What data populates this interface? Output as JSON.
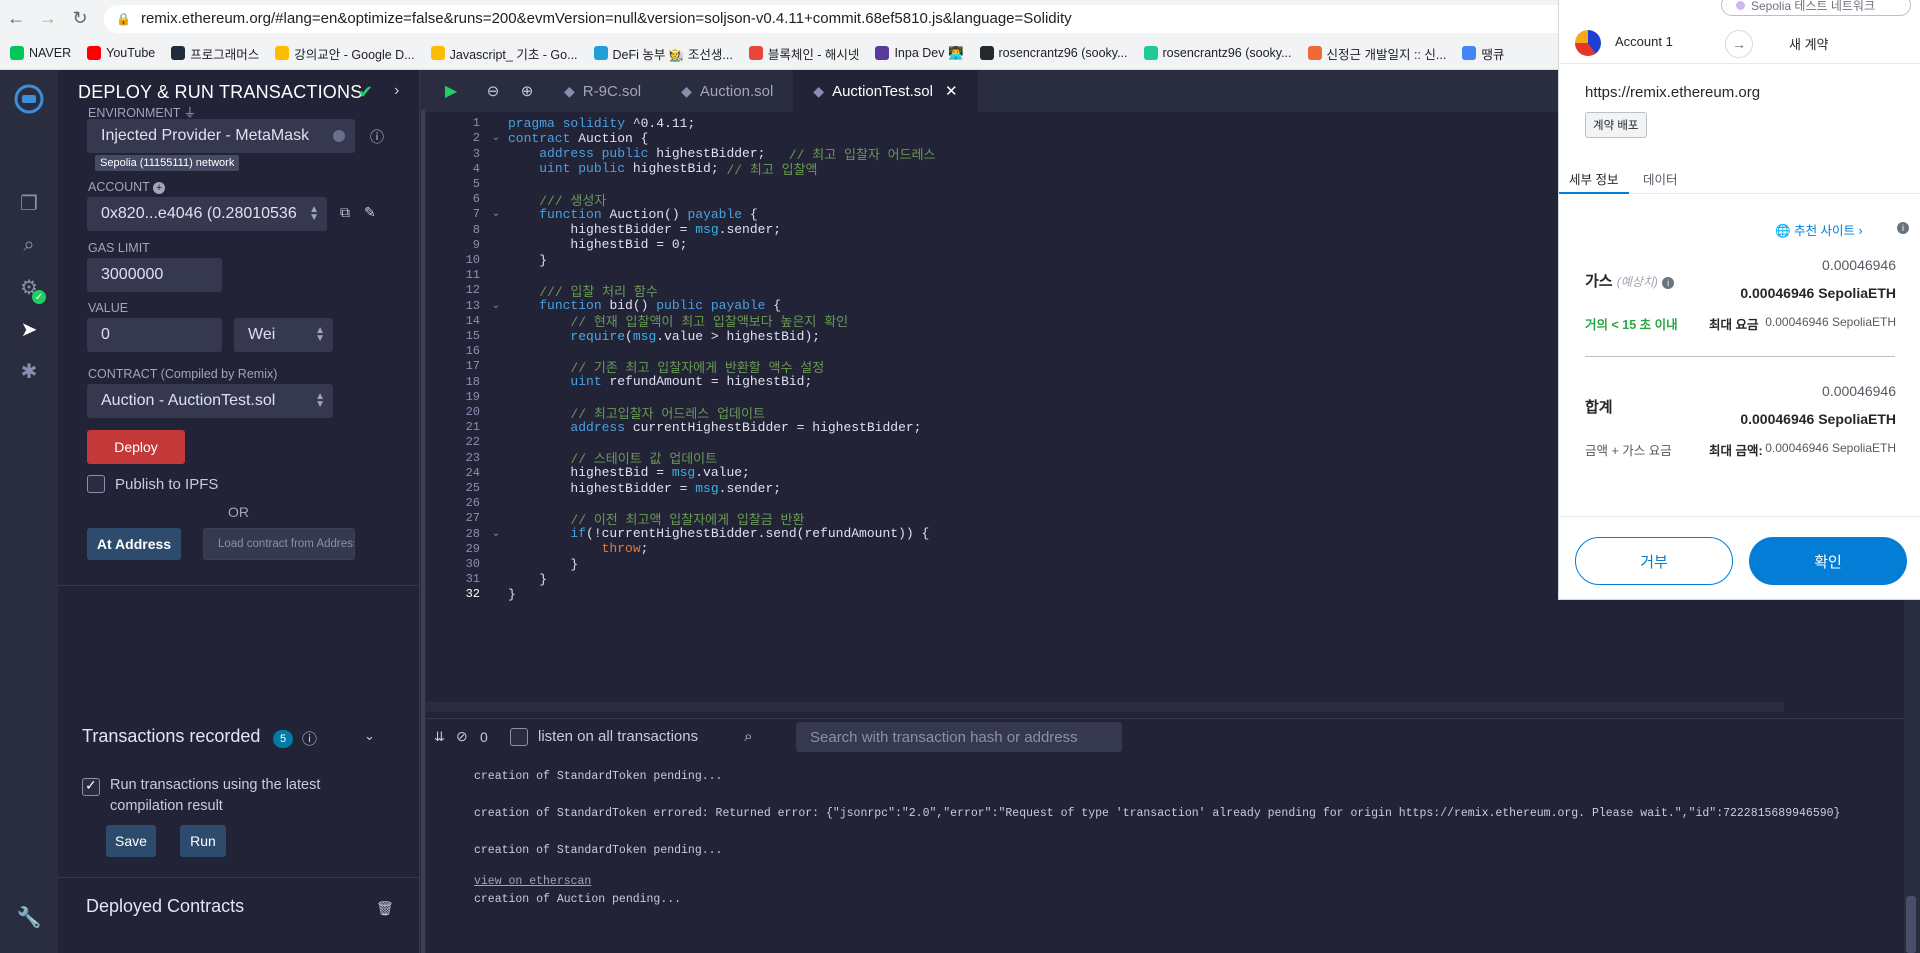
{
  "browser": {
    "url": "remix.ethereum.org/#lang=en&optimize=false&runs=200&evmVersion=null&version=soljson-v0.4.11+commit.68ef5810.js&language=Solidity",
    "bookmarks": [
      {
        "label": "NAVER",
        "color": "#03c75a"
      },
      {
        "label": "YouTube",
        "color": "#ff0000"
      },
      {
        "label": "프로그래머스",
        "color": "#202b3d"
      },
      {
        "label": "강의교안 - Google D...",
        "color": "#fbbc04"
      },
      {
        "label": "Javascript_ 기초 - Go...",
        "color": "#fbbc04"
      },
      {
        "label": "DeFi 농부 🧑‍🌾 조선생...",
        "color": "#229ed9"
      },
      {
        "label": "블록체인 - 해시넷",
        "color": "#e8453c"
      },
      {
        "label": "Inpa Dev 👨‍💻",
        "color": "#5b3a9e"
      },
      {
        "label": "rosencrantz96 (sooky...",
        "color": "#24292f"
      },
      {
        "label": "rosencrantz96 (sooky...",
        "color": "#20c997"
      },
      {
        "label": "신정근 개발일지 :: 신...",
        "color": "#f06a35"
      },
      {
        "label": "땡큐",
        "color": "#4285f4"
      }
    ]
  },
  "panel": {
    "title": "DEPLOY & RUN TRANSACTIONS",
    "environment_label": "ENVIRONMENT",
    "environment_value": "Injected Provider - MetaMask",
    "network_badge": "Sepolia (11155111) network",
    "account_label": "ACCOUNT",
    "account_value": "0x820...e4046 (0.28010536",
    "gas_limit_label": "GAS LIMIT",
    "gas_limit_value": "3000000",
    "value_label": "VALUE",
    "value_amount": "0",
    "value_unit": "Wei",
    "contract_label": "CONTRACT (Compiled by Remix)",
    "contract_value": "Auction - AuctionTest.sol",
    "deploy_label": "Deploy",
    "publish_label": "Publish to IPFS",
    "or_label": "OR",
    "at_address_label": "At Address",
    "load_placeholder": "Load contract from Address",
    "tx_recorded_label": "Transactions recorded",
    "tx_recorded_count": "5",
    "run_latest_label": "Run transactions using the latest compilation result",
    "save_label": "Save",
    "run_label": "Run",
    "deployed_label": "Deployed Contracts"
  },
  "editor": {
    "tabs": [
      "R-9C.sol",
      "Auction.sol",
      "AuctionTest.sol"
    ],
    "active_tab": "AuctionTest.sol"
  },
  "terminal": {
    "count": "0",
    "listen_label": "listen on all transactions",
    "search_placeholder": "Search with transaction hash or address",
    "lines": [
      "creation of StandardToken pending...",
      "creation of StandardToken errored: Returned error: {\"jsonrpc\":\"2.0\",\"error\":\"Request of type 'transaction' already pending for origin https://remix.ethereum.org. Please wait.\",\"id\":7222815689946590}",
      "creation of StandardToken pending...",
      "view on etherscan",
      "creation of Auction pending..."
    ]
  },
  "metamask": {
    "network": "Sepolia 테스트 네트워크",
    "account": "Account 1",
    "new_contract": "새 계약",
    "origin": "https://remix.ethereum.org",
    "tag": "계약 배포",
    "tab_details": "세부 정보",
    "tab_data": "데이터",
    "recommended_site": "추천 사이트",
    "gas_label": "가스",
    "gas_estimate": "(예상치)",
    "gas_small": "0.00046946",
    "gas_bold": "0.00046946 SepoliaETH",
    "time_estimate": "거의 < 15 초 이내",
    "max_fee_label": "최대 요금",
    "max_fee_value": "0.00046946 SepoliaETH",
    "total_label": "합계",
    "total_small": "0.00046946",
    "total_bold": "0.00046946 SepoliaETH",
    "amount_gas_label": "금액 + 가스 요금",
    "max_amount_label": "최대 금액:",
    "max_amount_value": "0.00046946 SepoliaETH",
    "reject_label": "거부",
    "confirm_label": "확인",
    "accent_color": "#037dd6"
  }
}
